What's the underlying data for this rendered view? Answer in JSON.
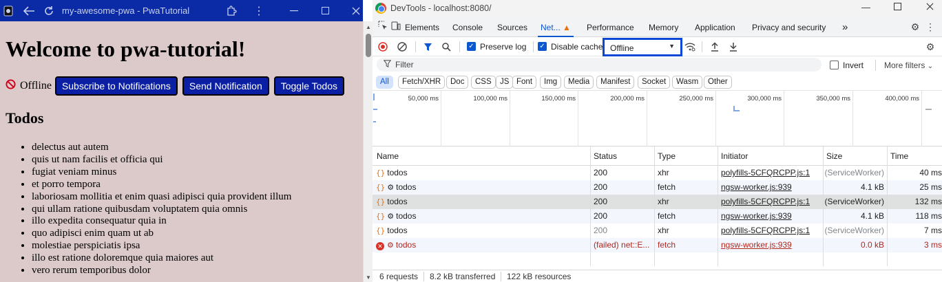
{
  "pwa": {
    "window_title": "my-awesome-pwa - PwaTutorial",
    "heading": "Welcome to pwa-tutorial!",
    "status_text": "Offline",
    "buttons": {
      "subscribe": "Subscribe to Notifications",
      "send": "Send Notification",
      "toggle": "Toggle Todos"
    },
    "todos_heading": "Todos",
    "todos": [
      "delectus aut autem",
      "quis ut nam facilis et officia qui",
      "fugiat veniam minus",
      "et porro tempora",
      "laboriosam mollitia et enim quasi adipisci quia provident illum",
      "qui ullam ratione quibusdam voluptatem quia omnis",
      "illo expedita consequatur quia in",
      "quo adipisci enim quam ut ab",
      "molestiae perspiciatis ipsa",
      "illo est ratione doloremque quia maiores aut",
      "vero rerum temporibus dolor"
    ],
    "icons": [
      "app-icon",
      "back-icon",
      "reload-icon",
      "extension-icon",
      "more-icon",
      "close-icon"
    ]
  },
  "devtools": {
    "window_title": "DevTools - localhost:8080/",
    "tabs": {
      "elements": "Elements",
      "console": "Console",
      "sources": "Sources",
      "network": "Net...",
      "performance": "Performance",
      "memory": "Memory",
      "application": "Application",
      "privacy": "Privacy and security",
      "more": "»"
    },
    "toolbar": {
      "preserve_log": "Preserve log",
      "disable_cache": "Disable cache",
      "throttle_value": "Offline"
    },
    "filter": {
      "placeholder": "Filter",
      "invert": "Invert",
      "more_filters": "More filters"
    },
    "chips": {
      "all": "All",
      "fetch": "Fetch/XHR",
      "doc": "Doc",
      "css": "CSS",
      "js": "JS",
      "font": "Font",
      "img": "Img",
      "media": "Media",
      "manifest": "Manifest",
      "socket": "Socket",
      "wasm": "Wasm",
      "other": "Other"
    },
    "overview_labels": {
      "t1": "50,000 ms",
      "t2": "100,000 ms",
      "t3": "150,000 ms",
      "t4": "200,000 ms",
      "t5": "250,000 ms",
      "t6": "300,000 ms",
      "t7": "350,000 ms",
      "t8": "400,000 ms"
    },
    "columns": {
      "name": "Name",
      "status": "Status",
      "type": "Type",
      "initiator": "Initiator",
      "size": "Size",
      "time": "Time"
    },
    "rows": [
      {
        "name": "todos",
        "sw": false,
        "status": "200",
        "type": "xhr",
        "initiator": "polyfills-5CFQRCPP.js:1",
        "size": "(ServiceWorker)",
        "time": "40 ms"
      },
      {
        "name": "todos",
        "sw": true,
        "status": "200",
        "type": "fetch",
        "initiator": "ngsw-worker.js:939",
        "size": "4.1 kB",
        "time": "25 ms"
      },
      {
        "name": "todos",
        "sw": false,
        "status": "200",
        "type": "xhr",
        "initiator": "polyfills-5CFQRCPP.js:1",
        "size": "(ServiceWorker)",
        "time": "132 ms"
      },
      {
        "name": "todos",
        "sw": true,
        "status": "200",
        "type": "fetch",
        "initiator": "ngsw-worker.js:939",
        "size": "4.1 kB",
        "time": "118 ms"
      },
      {
        "name": "todos",
        "sw": false,
        "status": "200",
        "type": "xhr",
        "initiator": "polyfills-5CFQRCPP.js:1",
        "size": "(ServiceWorker)",
        "time": "7 ms"
      },
      {
        "name": "todos",
        "sw": true,
        "status": "(failed) net::E...",
        "type": "fetch",
        "initiator": "ngsw-worker.js:939",
        "size": "0.0 kB",
        "time": "3 ms"
      }
    ],
    "status_bar": {
      "requests": "6 requests",
      "transferred": "8.2 kB transferred",
      "resources": "122 kB resources"
    }
  }
}
